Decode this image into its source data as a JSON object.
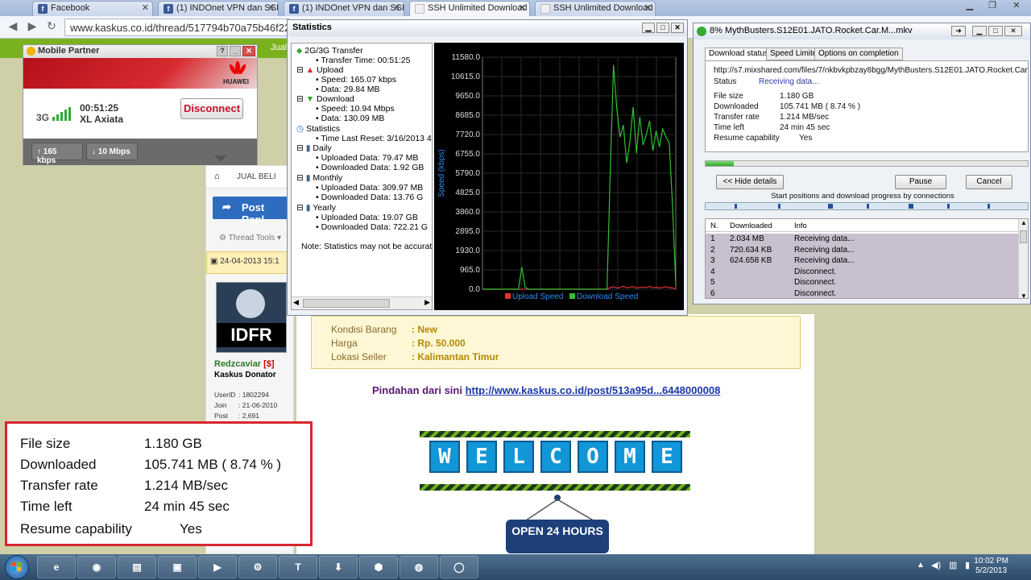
{
  "browser": {
    "tabs": [
      {
        "label": "Facebook",
        "icon": "facebook-icon"
      },
      {
        "label": "(1) INDOnet VPN dan SSH",
        "icon": "facebook-icon"
      },
      {
        "label": "(1) INDOnet VPN dan SSH",
        "icon": "facebook-icon"
      },
      {
        "label": "SSH Unlimited Download",
        "icon": "page-icon",
        "active": true
      },
      {
        "label": "SSH Unlimited Download",
        "icon": "page-icon"
      }
    ],
    "url": "www.kaskus.co.id/thread/517794b70a75b46f2200"
  },
  "mobile_partner": {
    "title": "Mobile Partner",
    "brand": "HUAWEI",
    "network": "3G",
    "time": "00:51:25",
    "operator": "XL Axiata",
    "disconnect_label": "Disconnect",
    "upload_speed": "165 kbps",
    "download_speed": "10 Mbps"
  },
  "statistics": {
    "title": "Statistics",
    "tree": {
      "transfer_header": "2G/3G Transfer",
      "transfer_time": "Transfer Time: 00:51:25",
      "upload": "Upload",
      "upload_speed": "Speed: 165.07 kbps",
      "upload_data": "Data: 29.84 MB",
      "download": "Download",
      "download_speed": "Speed: 10.94 Mbps",
      "download_data": "Data: 130.09 MB",
      "stats_header": "Statistics",
      "last_reset": "Time Last Reset: 3/16/2013 4:0",
      "daily": "Daily",
      "daily_up": "Uploaded Data: 79.47 MB",
      "daily_down": "Downloaded Data: 1.92 GB",
      "monthly": "Monthly",
      "monthly_up": "Uploaded Data: 309.97 MB",
      "monthly_down": "Downloaded Data: 13.76 G",
      "yearly": "Yearly",
      "yearly_up": "Uploaded Data: 19.07 GB",
      "yearly_down": "Downloaded Data: 722.21 G",
      "note": "Note: Statistics may not be accurate"
    }
  },
  "chart_data": {
    "type": "line",
    "ylabel": "Speed (kbps)",
    "ylim": [
      0,
      11580
    ],
    "yticks": [
      "11580.0",
      "10615.0",
      "9650.0",
      "8685.0",
      "7720.0",
      "6755.0",
      "5790.0",
      "4825.0",
      "3860.0",
      "2895.0",
      "1930.0",
      "965.0",
      "0.0"
    ],
    "series": [
      {
        "name": "Upload Speed",
        "color": "#e03030",
        "values": [
          0,
          0,
          0,
          0,
          0,
          0,
          0,
          0,
          0,
          0,
          0,
          0,
          0,
          0,
          0,
          0,
          0,
          0,
          0,
          0,
          0,
          0,
          0,
          0,
          0,
          0,
          0,
          0,
          0,
          0,
          0,
          0,
          0,
          0,
          0,
          0,
          0,
          0,
          0,
          80,
          120,
          60,
          90,
          150,
          70,
          100,
          130,
          60,
          90,
          110,
          80,
          140,
          70,
          100,
          60,
          90,
          120,
          80,
          70,
          0
        ]
      },
      {
        "name": "Download Speed",
        "color": "#30c030",
        "values": [
          0,
          0,
          0,
          0,
          0,
          0,
          0,
          0,
          0,
          0,
          0,
          0,
          1100,
          100,
          0,
          0,
          0,
          0,
          0,
          0,
          0,
          0,
          0,
          0,
          0,
          0,
          0,
          0,
          0,
          0,
          0,
          0,
          0,
          0,
          0,
          0,
          0,
          0,
          0,
          5800,
          11200,
          9000,
          7600,
          8200,
          6300,
          7400,
          9100,
          6800,
          8600,
          7200,
          7700,
          8400,
          6900,
          7900,
          7100,
          8000,
          7600,
          7300,
          4200,
          200
        ]
      }
    ]
  },
  "download": {
    "title": "8% MythBusters.S12E01.JATO.Rocket.Car.M...mkv",
    "tabs": [
      "Download status",
      "Speed Limiter",
      "Options on completion"
    ],
    "source_url": "http://s7.mixshared.com/files/7/nkbvkpbzay8bgg/MythBusters.S12E01.JATO.Rocket.Car.Mission.A",
    "status_label": "Status",
    "status_value": "Receiving data...",
    "file_size_label": "File size",
    "file_size": "1.180  GB",
    "downloaded_label": "Downloaded",
    "downloaded": "105.741  MB  ( 8.74 % )",
    "rate_label": "Transfer rate",
    "rate": "1.214  MB/sec",
    "time_left_label": "Time left",
    "time_left": "24 min 45 sec",
    "resume_label": "Resume capability",
    "resume": "Yes",
    "progress": 0.0874,
    "hide_details": "<< Hide details",
    "pause": "Pause",
    "cancel": "Cancel",
    "connections_caption": "Start positions and download progress by connections",
    "table_headers": [
      "N.",
      "Downloaded",
      "Info"
    ],
    "rows": [
      {
        "n": "1",
        "downloaded": "2.034  MB",
        "info": "Receiving data..."
      },
      {
        "n": "2",
        "downloaded": "720.634  KB",
        "info": "Receiving data..."
      },
      {
        "n": "3",
        "downloaded": "624.658  KB",
        "info": "Receiving data..."
      },
      {
        "n": "4",
        "downloaded": "",
        "info": "Disconnect."
      },
      {
        "n": "5",
        "downloaded": "",
        "info": "Disconnect."
      },
      {
        "n": "6",
        "downloaded": "",
        "info": "Disconnect."
      }
    ]
  },
  "page": {
    "green_label": "Jual",
    "breadcrumb": "JUAL BELI",
    "post_reply": "Post Repl",
    "thread_tools": "Thread Tools",
    "post_date": "24-04-2013 15:1",
    "avatar_text": "IDFR",
    "username": "Redzcaviar",
    "user_flag": "[$]",
    "user_title": "Kaskus Donator",
    "user_id_label": "UserID",
    "user_id": ": 1802294",
    "join_label": "Join",
    "join": ": 21-06-2010",
    "post_label": "Post",
    "posts": ": 2,691",
    "info": [
      {
        "label": "Kondisi Barang",
        "value": ": New"
      },
      {
        "label": "Harga",
        "value": ": Rp. 50.000"
      },
      {
        "label": "Lokasi Seller",
        "value": ": Kalimantan Timur"
      }
    ],
    "moved_text": "Pindahan dari sini ",
    "moved_link": "http://www.kaskus.co.id/post/513a95d...6448000008",
    "welcome_letters": [
      "W",
      "E",
      "L",
      "C",
      "O",
      "M",
      "E"
    ],
    "open_sign": "OPEN 24 HOURS"
  },
  "zoom": {
    "file_size_label": "File size",
    "file_size": "1.180  GB",
    "downloaded_label": "Downloaded",
    "downloaded": "105.741  MB  ( 8.74 % )",
    "rate_label": "Transfer rate",
    "rate": "1.214  MB/sec",
    "time_left_label": "Time left",
    "time_left": "24 min 45 sec",
    "resume_label": "Resume capability",
    "resume": "Yes"
  },
  "taskbar": {
    "time": "10:02 PM",
    "date": "5/2/2013"
  }
}
